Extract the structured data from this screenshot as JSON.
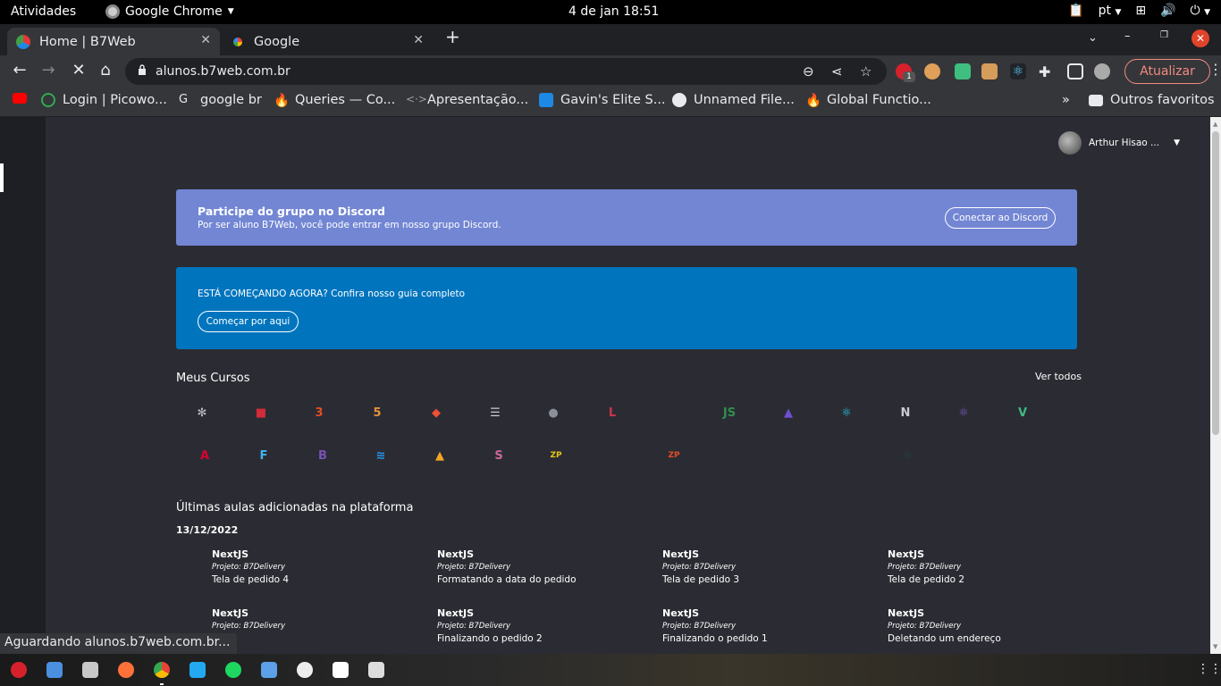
{
  "system": {
    "activities": "Atividades",
    "app_name": "Google Chrome",
    "clock": "4 de jan  18:51",
    "lang": "pt"
  },
  "tabs": [
    {
      "title": "Home | B7Web",
      "active": true
    },
    {
      "title": "Google",
      "active": false
    }
  ],
  "toolbar": {
    "url": "alunos.b7web.com.br",
    "update_label": "Atualizar",
    "extension_badge": "1"
  },
  "bookmarks": [
    {
      "label": "Login | Picowo..."
    },
    {
      "label": "google br"
    },
    {
      "label": "Queries — Co..."
    },
    {
      "label": "Apresentação..."
    },
    {
      "label": "Gavin's Elite S..."
    },
    {
      "label": "Unnamed File..."
    },
    {
      "label": "Global Functio..."
    },
    {
      "label": "Outros favoritos"
    }
  ],
  "page": {
    "user_name": "Arthur Hisao ...",
    "discord": {
      "title": "Participe do grupo no Discord",
      "subtitle": "Por ser aluno B7Web, você pode entrar em nosso grupo Discord.",
      "button": "Conectar ao Discord"
    },
    "start": {
      "text": "ESTÁ COMEÇANDO AGORA? Confira nosso guia completo",
      "button": "Começar por aqui"
    },
    "courses_heading": "Meus Cursos",
    "see_all": "Ver todos",
    "courses": [
      {
        "icon": "kubernetes-icon",
        "color": "#bfc3c9",
        "glyph": "✻"
      },
      {
        "icon": "video-icon",
        "color": "#d42a3a",
        "glyph": "■"
      },
      {
        "icon": "css3-icon",
        "color": "#e44d26",
        "glyph": "3"
      },
      {
        "icon": "html5-icon",
        "color": "#e8913a",
        "glyph": "5"
      },
      {
        "icon": "git-icon",
        "color": "#f05033",
        "glyph": "◆"
      },
      {
        "icon": "server-icon",
        "color": "#c9cbd1",
        "glyph": "☰"
      },
      {
        "icon": "postgresql-icon",
        "color": "#8a8f99",
        "glyph": "●"
      },
      {
        "icon": "laravel-icon",
        "color": "#d0344a",
        "glyph": "L"
      },
      {
        "icon": "nodejs-icon",
        "color": "#2f8f4e",
        "glyph": "JS"
      },
      {
        "icon": "adonis-icon",
        "color": "#6f4fd9",
        "glyph": "▲"
      },
      {
        "icon": "react-icon",
        "color": "#2cc7e8",
        "glyph": "⚛"
      },
      {
        "icon": "nextjs-icon",
        "color": "#c9cbd1",
        "glyph": "N"
      },
      {
        "icon": "redux-icon",
        "color": "#7a5ccc",
        "glyph": "⚛"
      },
      {
        "icon": "vue-icon",
        "color": "#41b883",
        "glyph": "V"
      },
      {
        "icon": "angular-icon",
        "color": "#dd0031",
        "glyph": "A"
      },
      {
        "icon": "flutter-icon",
        "color": "#3fb6f0",
        "glyph": "F"
      },
      {
        "icon": "bootstrap-icon",
        "color": "#7952b3",
        "glyph": "B"
      },
      {
        "icon": "docker-icon",
        "color": "#2496ed",
        "glyph": "≋"
      },
      {
        "icon": "firebase-icon",
        "color": "#f5a623",
        "glyph": "▲"
      },
      {
        "icon": "sass-icon",
        "color": "#cd6799",
        "glyph": "S"
      },
      {
        "icon": "zp-js-icon",
        "color": "#e5c51a",
        "glyph": "ZP"
      },
      {
        "icon": "zp-html-icon",
        "color": "#e44d26",
        "glyph": "ZP"
      },
      {
        "icon": "react-dark-icon",
        "color": "#20404a",
        "glyph": "⚛"
      }
    ],
    "latest_heading": "Últimas aulas adicionadas na plataforma",
    "latest_date": "13/12/2022",
    "lessons": [
      {
        "course": "NextJS",
        "project": "Projeto: B7Delivery",
        "name": "Tela de pedido 4"
      },
      {
        "course": "NextJS",
        "project": "Projeto: B7Delivery",
        "name": "Formatando a data do pedido"
      },
      {
        "course": "NextJS",
        "project": "Projeto: B7Delivery",
        "name": "Tela de pedido 3"
      },
      {
        "course": "NextJS",
        "project": "Projeto: B7Delivery",
        "name": "Tela de pedido 2"
      },
      {
        "course": "NextJS",
        "project": "Projeto: B7Delivery",
        "name": ""
      },
      {
        "course": "NextJS",
        "project": "Projeto: B7Delivery",
        "name": "Finalizando o pedido 2"
      },
      {
        "course": "NextJS",
        "project": "Projeto: B7Delivery",
        "name": "Finalizando o pedido 1"
      },
      {
        "course": "NextJS",
        "project": "Projeto: B7Delivery",
        "name": "Deletando um endereço"
      }
    ]
  },
  "status_text": "Aguardando alunos.b7web.com.br..."
}
